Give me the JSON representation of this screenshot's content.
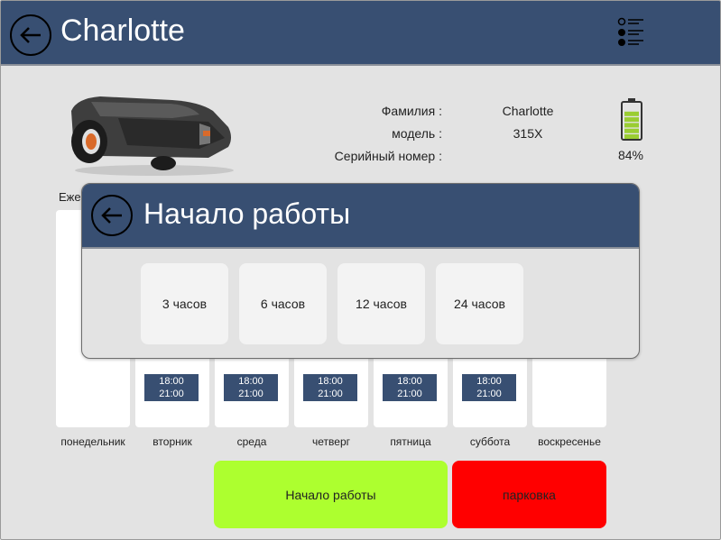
{
  "header": {
    "title": "Charlotte",
    "back_icon": "back-arrow-icon",
    "menu_icon": "list-menu-icon"
  },
  "info": {
    "labels": [
      "Фамилия :",
      "модель :",
      "Серийный номер :"
    ],
    "values": [
      "Charlotte",
      "315X",
      ""
    ]
  },
  "battery": {
    "percent": "84%",
    "level": 0.84,
    "color": "#9acd32"
  },
  "schedule": {
    "title": "Еже",
    "days": [
      {
        "label": "понедельник",
        "start": "",
        "end": ""
      },
      {
        "label": "вторник",
        "start": "18:00",
        "end": "21:00"
      },
      {
        "label": "среда",
        "start": "18:00",
        "end": "21:00"
      },
      {
        "label": "четверг",
        "start": "18:00",
        "end": "21:00"
      },
      {
        "label": "пятница",
        "start": "18:00",
        "end": "21:00"
      },
      {
        "label": "суббота",
        "start": "18:00",
        "end": "21:00"
      },
      {
        "label": "воскресенье",
        "start": "",
        "end": ""
      }
    ]
  },
  "actions": {
    "start_label": "Начало работы",
    "park_label": "парковка",
    "start_color": "#adff2f",
    "park_color": "#ff0000"
  },
  "modal": {
    "title": "Начало работы",
    "options": [
      "3 часов",
      "6 часов",
      "12 часов",
      "24 часов"
    ]
  },
  "colors": {
    "header": "#384f72",
    "background": "#e3e3e3"
  }
}
